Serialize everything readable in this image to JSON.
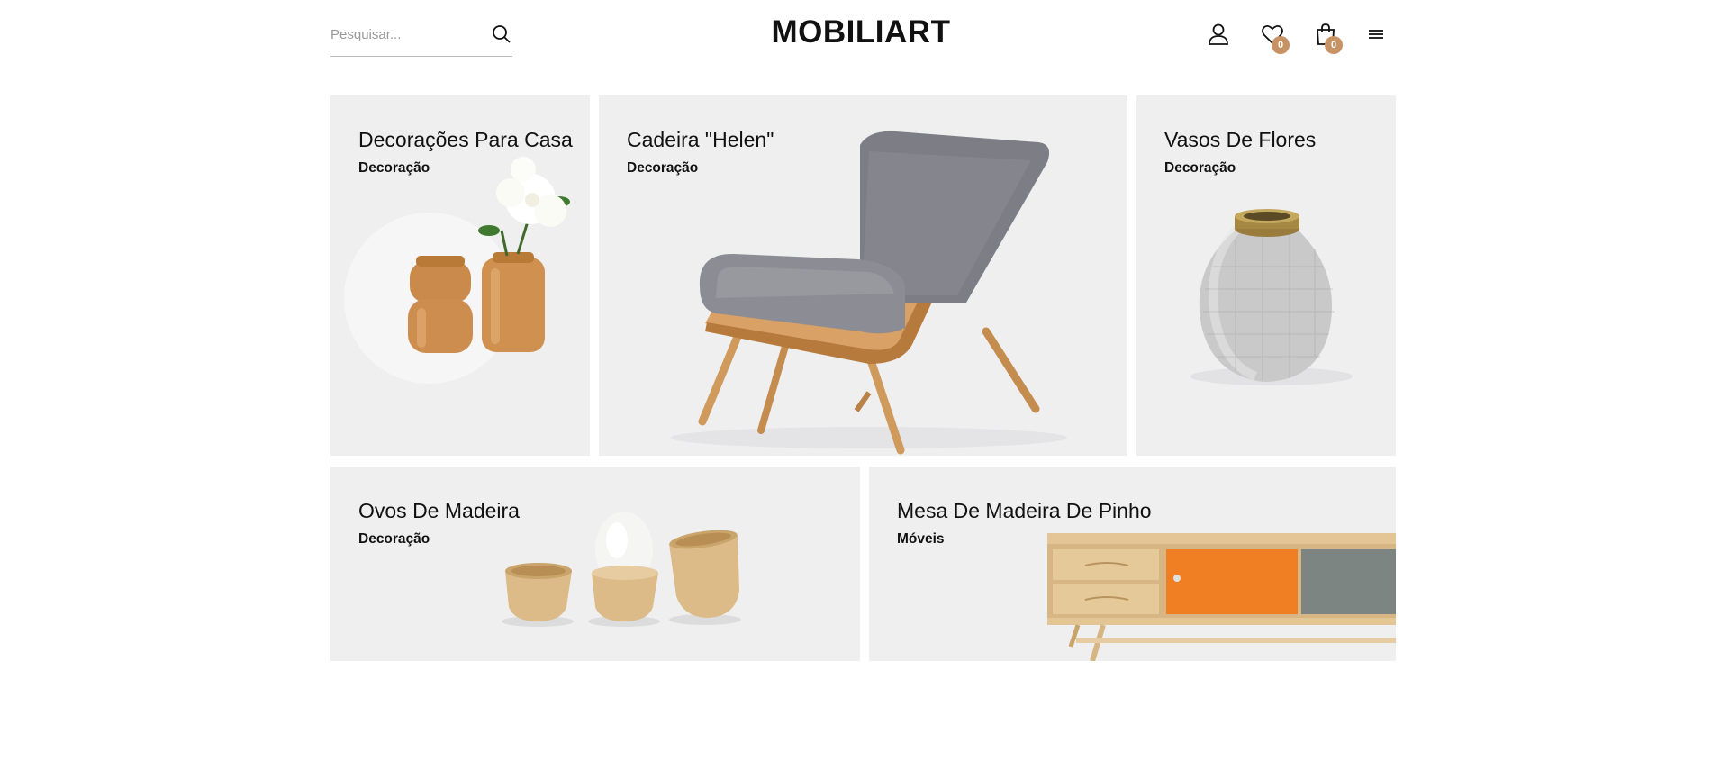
{
  "header": {
    "search_placeholder": "Pesquisar...",
    "logo": "MOBILIART",
    "wishlist_count": "0",
    "cart_count": "0",
    "icons": [
      "search-icon",
      "user-icon",
      "heart-icon",
      "bag-icon",
      "menu-icon"
    ],
    "badge_color": "#c89364"
  },
  "tiles": [
    {
      "title": "Decorações Para Casa",
      "category": "Decoração"
    },
    {
      "title": "Cadeira \"Helen\"",
      "category": "Decoração"
    },
    {
      "title": "Vasos De Flores",
      "category": "Decoração"
    },
    {
      "title": "Ovos De Madeira",
      "category": "Decoração"
    },
    {
      "title": "Mesa De Madeira De Pinho",
      "category": "Móveis"
    }
  ],
  "colors": {
    "tile_background": "#efeff0",
    "accent": "#c89364"
  }
}
